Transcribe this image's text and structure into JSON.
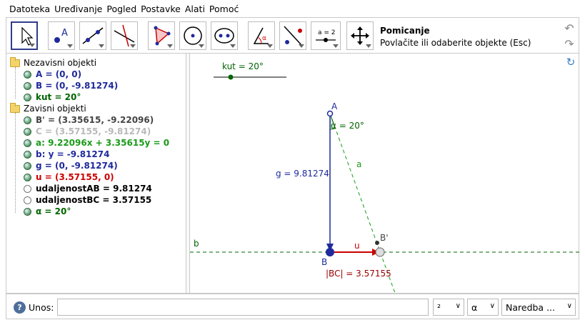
{
  "menu": [
    "Datoteka",
    "Uređivanje",
    "Pogled",
    "Postavke",
    "Alati",
    "Pomoć"
  ],
  "tool": {
    "name": "Pomicanje",
    "tooltip": "Povlačite ili odaberite objekte (Esc)"
  },
  "algebra": {
    "free_header": "Nezavisni objekti",
    "free": [
      {
        "text": "A = (0, 0)",
        "color": "#1f2a9c",
        "shown": true
      },
      {
        "text": "B = (0, -9.81274)",
        "color": "#1f2a9c",
        "shown": true
      },
      {
        "text": "kut = 20°",
        "color": "#006400",
        "shown": true
      }
    ],
    "dep_header": "Zavisni objekti",
    "dep": [
      {
        "text": "B' = (3.35615, -9.22096)",
        "color": "#444444",
        "shown": true
      },
      {
        "text": "C = (3.57155, -9.81274)",
        "color": "#b9b9b9",
        "shown": true
      },
      {
        "text": "a: 9.22096x + 3.35615y = 0",
        "color": "#1a9a1a",
        "shown": true
      },
      {
        "text": "b: y = -9.81274",
        "color": "#1f2a9c",
        "shown": true
      },
      {
        "text": "g = (0, -9.81274)",
        "color": "#1f2a9c",
        "shown": true
      },
      {
        "text": "u = (3.57155, 0)",
        "color": "#cc0000",
        "shown": true
      },
      {
        "text": "udaljenostAB = 9.81274",
        "color": "#000000",
        "shown": false
      },
      {
        "text": "udaljenostBC = 3.57155",
        "color": "#000000",
        "shown": false
      },
      {
        "text": "α = 20°",
        "color": "#006400",
        "shown": true
      }
    ]
  },
  "graphics": {
    "slider_label": "kut = 20°",
    "label_A": "A",
    "label_B": "B",
    "label_Bp": "B'",
    "label_alpha": "α = 20°",
    "label_g": "g = 9.81274",
    "label_a": "a",
    "label_b": "b",
    "label_u": "u",
    "label_BC": "|BC| = 3.57155"
  },
  "input": {
    "label": "Unos:",
    "value": "",
    "dd1": "²",
    "dd2": "α",
    "dd3": "Naredba ..."
  }
}
